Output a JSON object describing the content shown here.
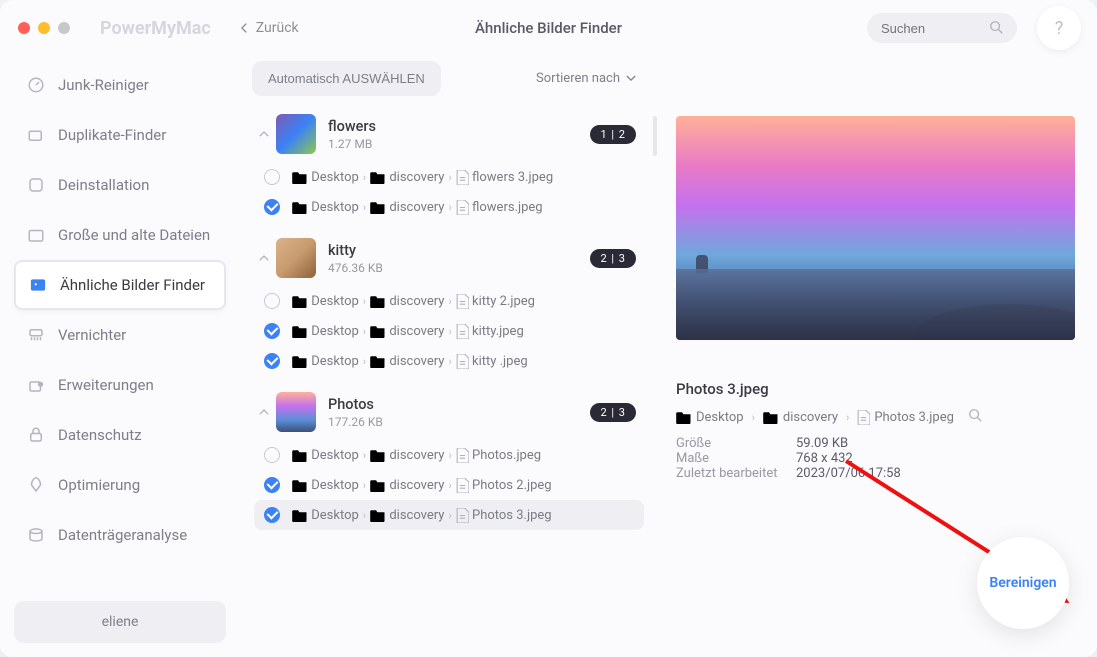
{
  "brand": "PowerMyMac",
  "back_label": "Zurück",
  "page_title": "Ähnliche Bilder Finder",
  "search": {
    "placeholder": "Suchen"
  },
  "help_label": "?",
  "sidebar": {
    "items": [
      {
        "label": "Junk-Reiniger"
      },
      {
        "label": "Duplikate-Finder"
      },
      {
        "label": "Deinstallation"
      },
      {
        "label": "Große und alte Dateien"
      },
      {
        "label": "Ähnliche Bilder Finder"
      },
      {
        "label": "Vernichter"
      },
      {
        "label": "Erweiterungen"
      },
      {
        "label": "Datenschutz"
      },
      {
        "label": "Optimierung"
      },
      {
        "label": "Datenträgeranalyse"
      }
    ],
    "user": "eliene"
  },
  "toolbar": {
    "auto_select": "Automatisch AUSWÄHLEN",
    "sort_label": "Sortieren nach"
  },
  "path": {
    "desktop": "Desktop",
    "discovery": "discovery"
  },
  "groups": [
    {
      "name": "flowers",
      "size": "1.27 MB",
      "badge": "1 | 2",
      "files": [
        {
          "name": "flowers 3.jpeg",
          "checked": false
        },
        {
          "name": "flowers.jpeg",
          "checked": true
        }
      ]
    },
    {
      "name": "kitty",
      "size": "476.36 KB",
      "badge": "2 | 3",
      "files": [
        {
          "name": "kitty 2.jpeg",
          "checked": false
        },
        {
          "name": "kitty.jpeg",
          "checked": true
        },
        {
          "name": "kitty .jpeg",
          "checked": true
        }
      ]
    },
    {
      "name": "Photos",
      "size": "177.26 KB",
      "badge": "2 | 3",
      "files": [
        {
          "name": "Photos.jpeg",
          "checked": false
        },
        {
          "name": "Photos 2.jpeg",
          "checked": true
        },
        {
          "name": "Photos 3.jpeg",
          "checked": true,
          "selected": true
        }
      ]
    }
  ],
  "preview": {
    "filename": "Photos 3.jpeg",
    "path_file": "Photos 3.jpeg",
    "meta": {
      "size_key": "Größe",
      "size_val": "59.09 KB",
      "dim_key": "Maße",
      "dim_val": "768 x 432",
      "mod_key": "Zuletzt bearbeitet",
      "mod_val": "2023/07/06 17:58"
    }
  },
  "clean_label": "Bereinigen"
}
